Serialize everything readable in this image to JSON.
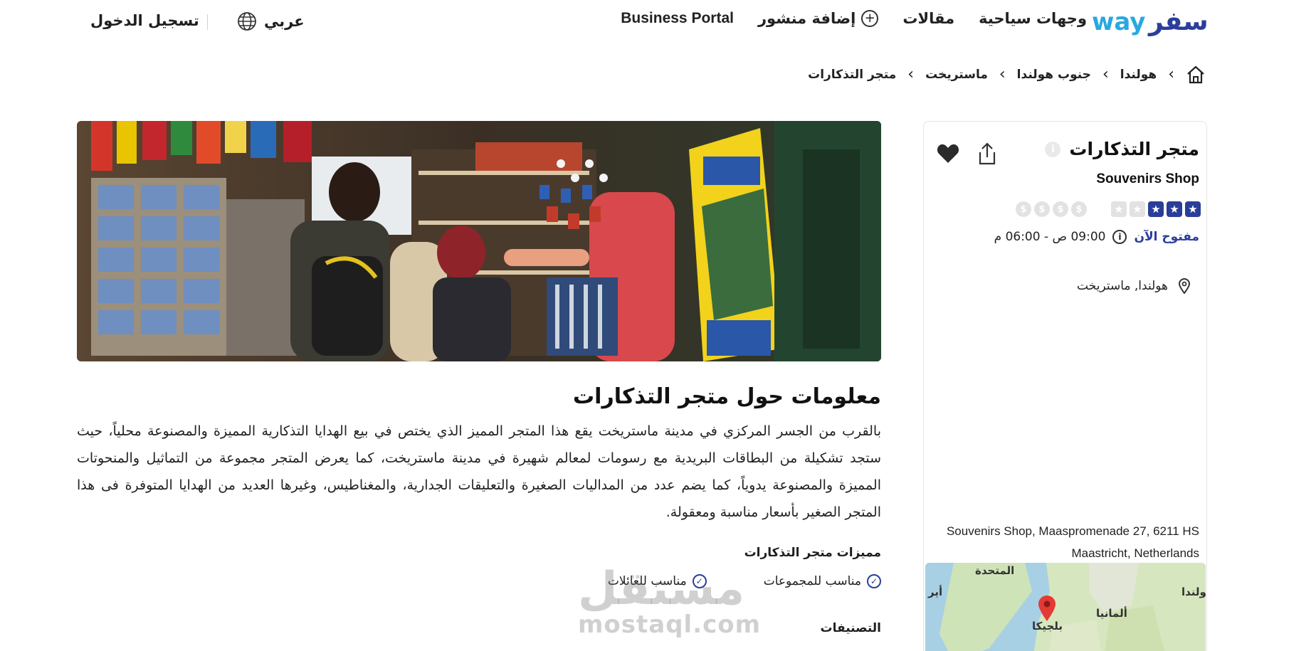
{
  "header": {
    "logo_text": "wayسفر",
    "nav": {
      "destinations": "وجهات سياحية",
      "articles": "مقالات",
      "add_post": "إضافة منشور",
      "business_portal": "Business Portal"
    },
    "language": "عربي",
    "login": "تسجيل الدخول"
  },
  "breadcrumb": [
    "هولندا",
    "جنوب هولندا",
    "ماستريخت",
    "متجر التذكارات"
  ],
  "hero": {
    "icon": "souvenir-shop-photo"
  },
  "about": {
    "title": "معلومات حول متجر التذكارات",
    "body": "بالقرب من الجسر المركزي في مدينة ماستريخت يقع هذا المتجر المميز الذي يختص في بيع الهدايا التذكارية المميزة والمصنوعة محلياً، حيث ستجد تشكيلة من البطاقات البريدية مع رسومات لمعالم شهيرة في مدينة ماستريخت، كما يعرض المتجر مجموعة من التماثيل والمنحوتات المميزة والمصنوعة يدوياً، كما يضم عدد من المداليات الصغيرة والتعليقات الجدارية، والمغناطيس، وغيرها العديد من الهدايا المتوفرة فى هذا المتجر الصغير بأسعار مناسبة ومعقولة.",
    "features_title": "مميزات متجر التذكارات",
    "features": [
      "مناسب للمجموعات",
      "مناسب للعائلات"
    ],
    "categories_title": "التصنيفات"
  },
  "watermark": {
    "ar": "مستقل",
    "en": "mostaql.com"
  },
  "card": {
    "title": "متجر التذكارات",
    "subtitle": "Souvenirs Shop",
    "rating": 3,
    "rating_max": 5,
    "price_level_max": 4,
    "price_symbol": "$",
    "open_status": "مفتوح الآن",
    "hours": "09:00 ص - 06:00 م",
    "location": "هولندا, ماستريخت",
    "address": "Souvenirs Shop, Maaspromenade 27, 6211 HS Maastricht, Netherlands",
    "map_labels": {
      "united": "المتحدة",
      "netherlands": "هولندا",
      "germany": "ألمانيا",
      "belgium": "بلجيكا",
      "ireland": "أير"
    }
  },
  "colors": {
    "brand_blue": "#2b3e9c",
    "logo_light": "#29a8e0",
    "star_on": "#2a3d98",
    "inactive": "#e2e2e2",
    "map_marker": "#e53935"
  }
}
